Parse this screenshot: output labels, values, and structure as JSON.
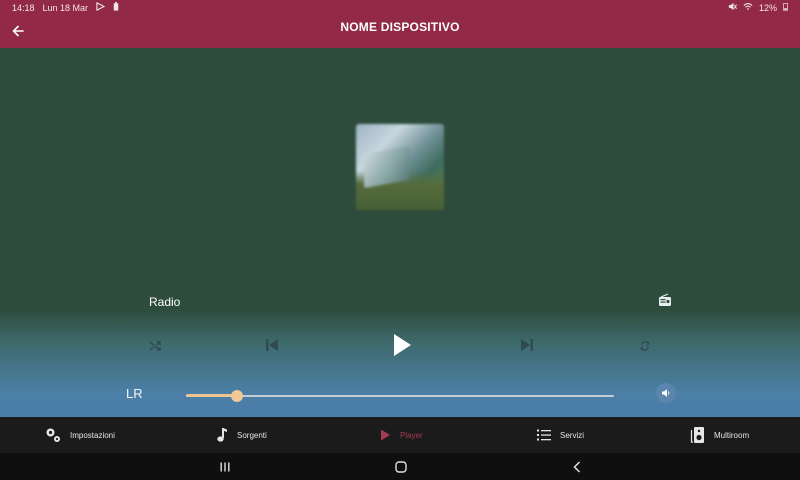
{
  "status": {
    "time": "14:18",
    "date": "Lun 18 Mar",
    "battery": "12%"
  },
  "header": {
    "title": "NOME DISPOSITIVO"
  },
  "player": {
    "source_label": "Radio",
    "channel_label": "LR",
    "volume_fraction": 0.12
  },
  "nav": {
    "items": [
      {
        "label": "Impostazioni",
        "icon": "settings-icon"
      },
      {
        "label": "Sorgenti",
        "icon": "music-note-icon"
      },
      {
        "label": "Player",
        "icon": "play-icon"
      },
      {
        "label": "Servizi",
        "icon": "list-icon"
      },
      {
        "label": "Multiroom",
        "icon": "speaker-icon"
      }
    ],
    "active": "Player"
  },
  "colors": {
    "appbar": "#922a47",
    "accent_active": "#a53a55",
    "slider_fill": "#efc693",
    "bg_top": "#2e4c3c",
    "bg_bottom": "#4a7ea9"
  }
}
